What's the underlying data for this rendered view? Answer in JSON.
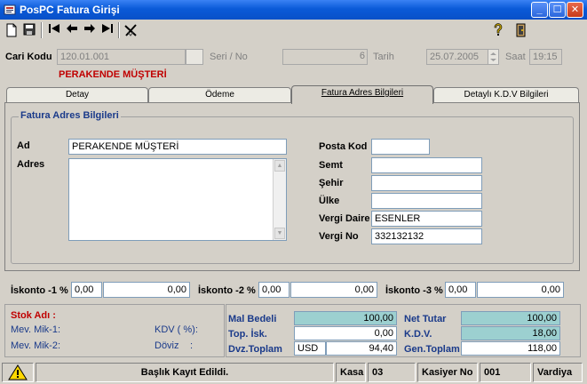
{
  "window": {
    "title": "PosPC Fatura Girişi"
  },
  "toolbar": {
    "icons": [
      "new-doc-icon",
      "save-icon",
      "first-icon",
      "prev-icon",
      "next-icon",
      "last-icon",
      "cancel-icon",
      "help-icon",
      "exit-icon"
    ]
  },
  "header": {
    "cari_kodu_label": "Cari Kodu",
    "cari_kodu_value": "120.01.001",
    "seri_no_label": "Seri / No",
    "seri_value": "",
    "no_value": "6",
    "tarih_label": "Tarih",
    "tarih_value": "25.07.2005",
    "saat_label": "Saat",
    "saat_value": "19:15",
    "customer_name": "PERAKENDE MÜŞTERİ"
  },
  "tabs": [
    "Detay",
    "Ödeme",
    "Fatura Adres Bilgileri",
    "Detaylı K.D.V Bilgileri"
  ],
  "active_tab": "Fatura Adres Bilgileri",
  "address": {
    "group_title": "Fatura Adres Bilgileri",
    "ad_label": "Ad",
    "ad_value": "PERAKENDE MÜŞTERİ",
    "adres_label": "Adres",
    "adres_value": "",
    "posta_kod_label": "Posta Kod",
    "posta_kod_value": "",
    "semt_label": "Semt",
    "semt_value": "",
    "sehir_label": "Şehir",
    "sehir_value": "",
    "ulke_label": "Ülke",
    "ulke_value": "",
    "vergi_daire_label": "Vergi Daire",
    "vergi_daire_value": "ESENLER",
    "vergi_no_label": "Vergi No",
    "vergi_no_value": "332132132"
  },
  "discounts": [
    {
      "label": "İskonto -1 %",
      "pct": "0,00",
      "amount": "0,00"
    },
    {
      "label": "İskonto -2 %",
      "pct": "0,00",
      "amount": "0,00"
    },
    {
      "label": "İskonto -3 %",
      "pct": "0,00",
      "amount": "0,00"
    }
  ],
  "stock": {
    "stok_adi_label": "Stok Adı :",
    "mev_mik1_label": "Mev. Mik-1:",
    "mev_mik2_label": "Mev. Mik-2:",
    "kdv_label": "KDV ( %):",
    "doviz_label": "Döviz",
    "doviz_colon": ":"
  },
  "totals": {
    "mal_bedeli_label": "Mal Bedeli",
    "mal_bedeli_value": "100,00",
    "top_isk_label": "Top. İsk.",
    "top_isk_value": "0,00",
    "dvz_toplam_label": "Dvz.Toplam",
    "dvz_currency": "USD",
    "dvz_toplam_value": "94,40",
    "net_tutar_label": "Net Tutar",
    "net_tutar_value": "100,00",
    "kdv_label": "K.D.V.",
    "kdv_value": "18,00",
    "gen_toplam_label": "Gen.Toplam",
    "gen_toplam_value": "118,00"
  },
  "status": {
    "message": "Başlık Kayıt Edildi.",
    "kasa_label": "Kasa",
    "kasa_value": "03",
    "kasiyer_label": "Kasiyer No",
    "kasiyer_value": "001",
    "vardiya_label": "Vardiya"
  },
  "colors": {
    "title_blue": "#0a5ad8",
    "accent_red": "#c00000",
    "teal_total": "#9cd0d0"
  }
}
